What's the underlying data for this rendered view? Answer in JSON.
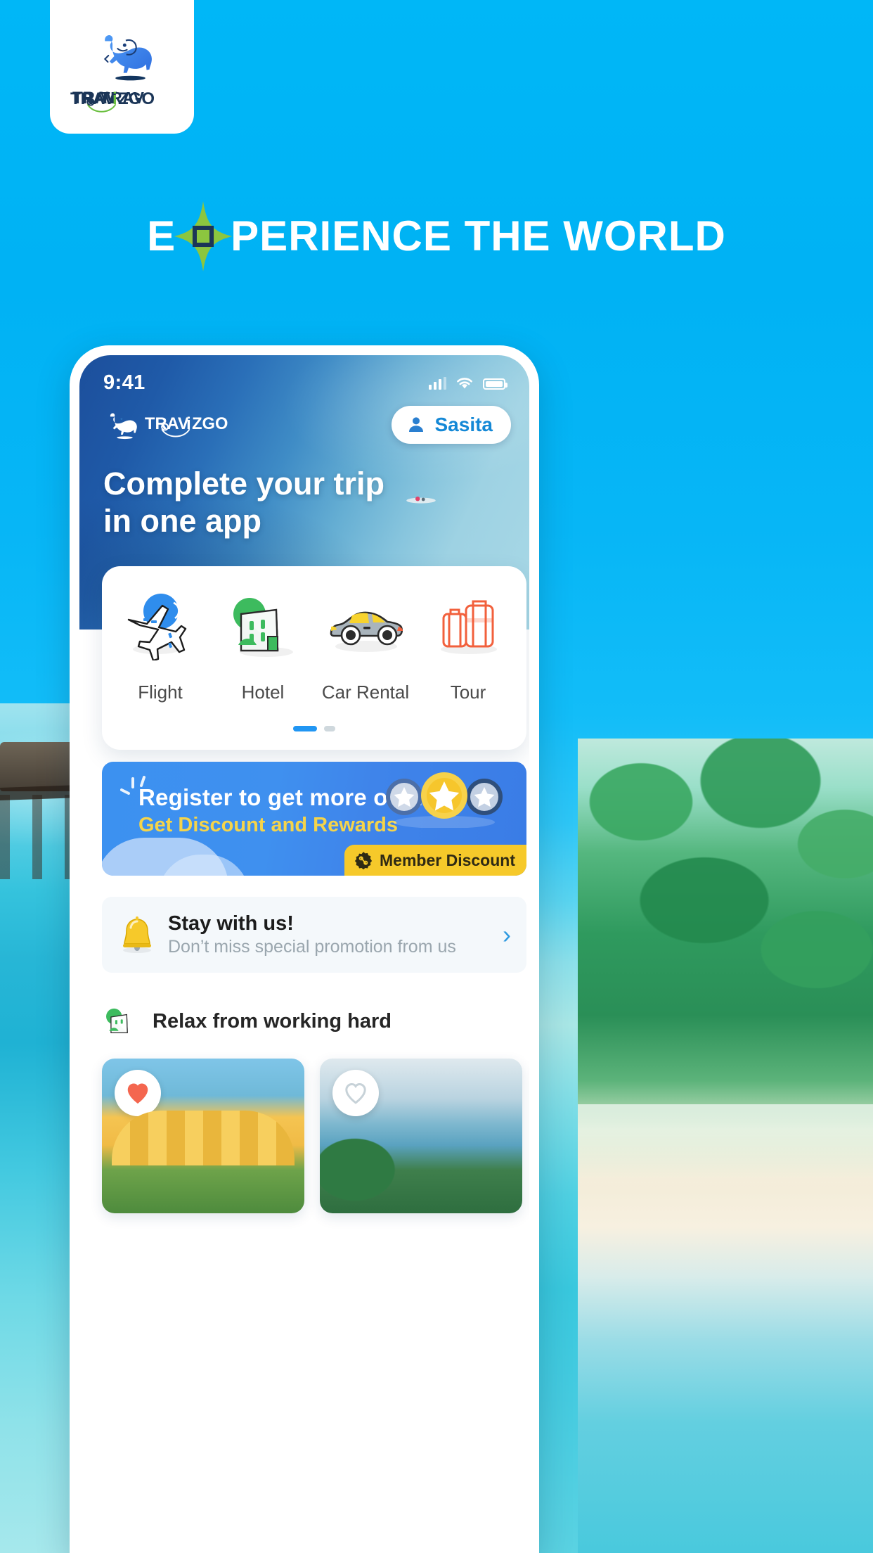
{
  "brand": {
    "name": "TRAVIZGO",
    "accent_blue": "#2196f3",
    "accent_green": "#8dc63f",
    "page_bg": "#00b4f5"
  },
  "headline": {
    "before": "E",
    "star_letter": "X",
    "after": "PERIENCE THE WORLD"
  },
  "phone": {
    "status_bar": {
      "time": "9:41",
      "icons": [
        "signal-icon",
        "wifi-icon",
        "battery-icon"
      ]
    },
    "header": {
      "logo_text": "TRAVIZGO",
      "user_button": {
        "label": "Sasita",
        "icon": "user-icon"
      }
    },
    "hero": {
      "title_line1": "Complete your trip",
      "title_line2": "in one app"
    },
    "services": {
      "items": [
        {
          "label": "Flight",
          "icon": "airplane-icon"
        },
        {
          "label": "Hotel",
          "icon": "hotel-building-icon"
        },
        {
          "label": "Car Rental",
          "icon": "car-icon"
        },
        {
          "label": "Tour",
          "icon": "luggage-icon"
        }
      ],
      "pagination": {
        "total": 2,
        "active": 1
      }
    },
    "promo_banner": {
      "title": "Register to get more offer!",
      "subtitle": "Get Discount and Rewards",
      "badge_label": "Member Discount",
      "badge_icon": "discount-seal-icon",
      "stars_icon": "three-stars-icon",
      "bg_color": "#3c8ded",
      "subtitle_color": "#f5d44a",
      "badge_color": "#f6c92a"
    },
    "stay_card": {
      "icon": "bell-icon",
      "title": "Stay with us!",
      "subtitle": "Don’t miss special promotion from us",
      "chevron": "chevron-right-icon"
    },
    "relax_section": {
      "icon": "hotel-building-icon",
      "title": "Relax from working hard",
      "cards": [
        {
          "favorite": true,
          "heart_icon": "heart-filled-icon"
        },
        {
          "favorite": false,
          "heart_icon": "heart-outline-icon"
        },
        {
          "favorite": false,
          "heart_icon": "heart-outline-icon"
        }
      ]
    }
  }
}
